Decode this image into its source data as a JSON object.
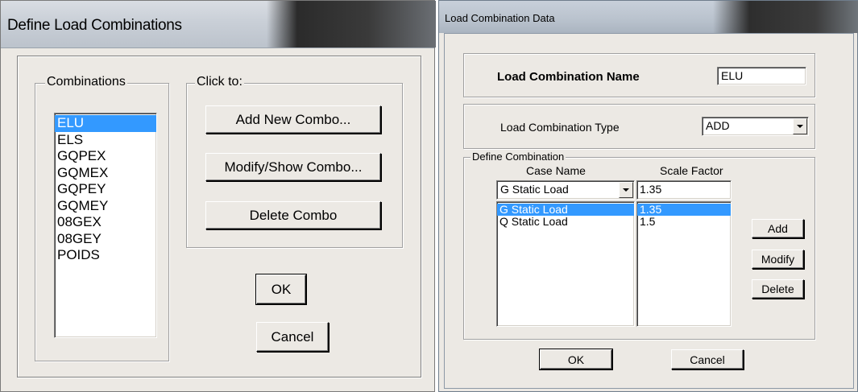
{
  "left_dialog": {
    "title": "Define Load Combinations",
    "combinations_label": "Combinations",
    "combinations": [
      "ELU",
      "ELS",
      "GQPEX",
      "GQMEX",
      "GQPEY",
      "GQMEY",
      "08GEX",
      "08GEY",
      "POIDS"
    ],
    "selected_combination": "ELU",
    "click_to_label": "Click to:",
    "add_button": "Add New Combo...",
    "modify_button": "Modify/Show Combo...",
    "delete_button": "Delete Combo",
    "ok_button": "OK",
    "cancel_button": "Cancel"
  },
  "right_dialog": {
    "title": "Load Combination Data",
    "name_label": "Load Combination Name",
    "name_value": "ELU",
    "type_label": "Load Combination Type",
    "type_value": "ADD",
    "define_label": "Define Combination",
    "case_name_header": "Case Name",
    "scale_factor_header": "Scale Factor",
    "case_select_value": "G Static Load",
    "scale_input_value": "1.35",
    "rows": [
      {
        "case": "G Static Load",
        "scale": "1.35",
        "selected": true
      },
      {
        "case": "Q Static Load",
        "scale": "1.5",
        "selected": false
      }
    ],
    "add_button": "Add",
    "modify_button": "Modify",
    "delete_button": "Delete",
    "ok_button": "OK",
    "cancel_button": "Cancel"
  }
}
